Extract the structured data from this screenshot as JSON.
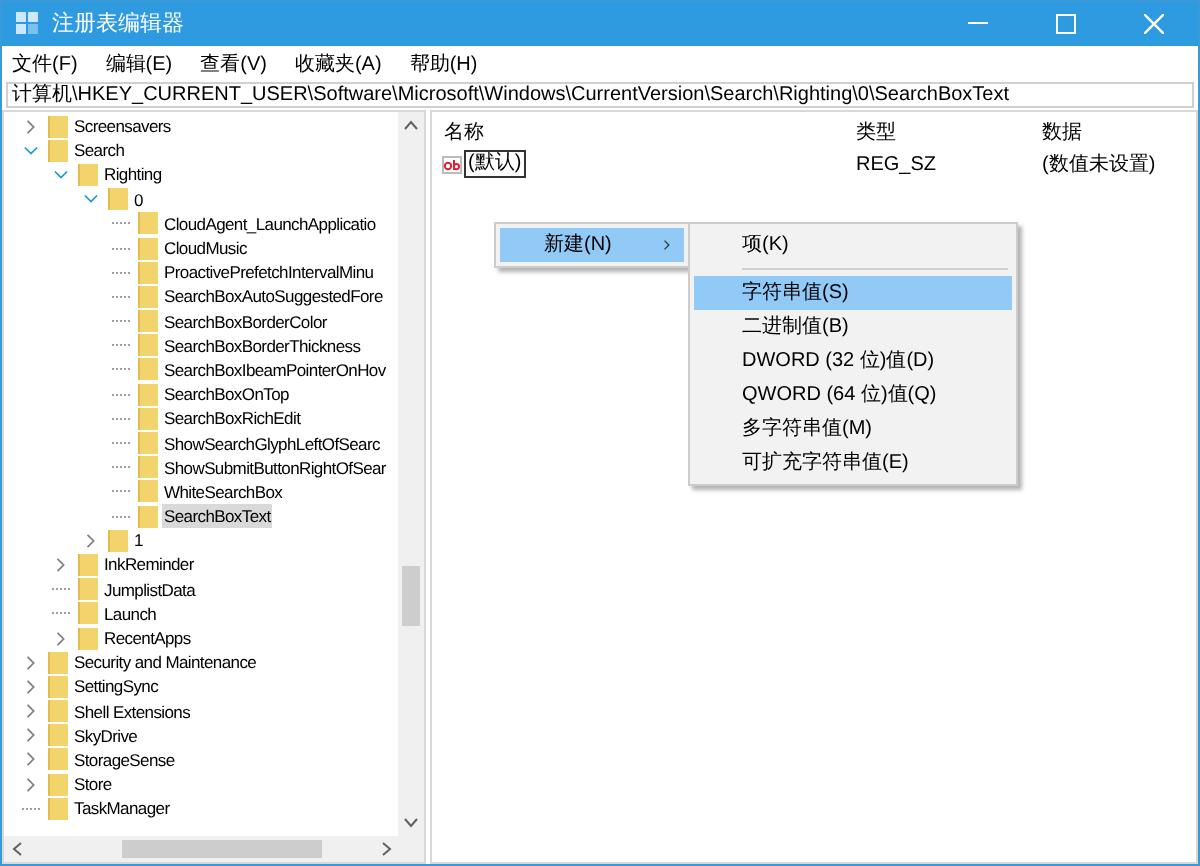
{
  "window": {
    "title": "注册表编辑器"
  },
  "menu_bar": [
    "文件(F)",
    "编辑(E)",
    "查看(V)",
    "收藏夹(A)",
    "帮助(H)"
  ],
  "address_bar": {
    "value": "计算机\\HKEY_CURRENT_USER\\Software\\Microsoft\\Windows\\CurrentVersion\\Search\\Righting\\0\\SearchBoxText"
  },
  "tree": {
    "items": [
      {
        "label": "Screensavers",
        "kind": "branch",
        "expanded": false,
        "selected": false
      },
      {
        "label": "Search",
        "kind": "branch",
        "expanded": true,
        "selected": false,
        "children": [
          {
            "label": "Righting",
            "kind": "branch",
            "expanded": true,
            "selected": false,
            "children": [
              {
                "label": "0",
                "kind": "branch",
                "expanded": true,
                "selected": false,
                "children": [
                  {
                    "label": "CloudAgent_LaunchApplicatio",
                    "kind": "leaf",
                    "selected": false
                  },
                  {
                    "label": "CloudMusic",
                    "kind": "leaf",
                    "selected": false
                  },
                  {
                    "label": "ProactivePrefetchIntervalMinu",
                    "kind": "leaf",
                    "selected": false
                  },
                  {
                    "label": "SearchBoxAutoSuggestedFore",
                    "kind": "leaf",
                    "selected": false
                  },
                  {
                    "label": "SearchBoxBorderColor",
                    "kind": "leaf",
                    "selected": false
                  },
                  {
                    "label": "SearchBoxBorderThickness",
                    "kind": "leaf",
                    "selected": false
                  },
                  {
                    "label": "SearchBoxIbeamPointerOnHov",
                    "kind": "leaf",
                    "selected": false
                  },
                  {
                    "label": "SearchBoxOnTop",
                    "kind": "leaf",
                    "selected": false
                  },
                  {
                    "label": "SearchBoxRichEdit",
                    "kind": "leaf",
                    "selected": false
                  },
                  {
                    "label": "ShowSearchGlyphLeftOfSearc",
                    "kind": "leaf",
                    "selected": false
                  },
                  {
                    "label": "ShowSubmitButtonRightOfSear",
                    "kind": "leaf",
                    "selected": false
                  },
                  {
                    "label": "WhiteSearchBox",
                    "kind": "leaf",
                    "selected": false
                  },
                  {
                    "label": "SearchBoxText",
                    "kind": "leaf",
                    "selected": true
                  }
                ]
              },
              {
                "label": "1",
                "kind": "branch",
                "expanded": false,
                "selected": false
              }
            ]
          },
          {
            "label": "InkReminder",
            "kind": "branch",
            "expanded": false,
            "selected": false
          },
          {
            "label": "JumplistData",
            "kind": "leaf",
            "selected": false
          },
          {
            "label": "Launch",
            "kind": "leaf",
            "selected": false
          },
          {
            "label": "RecentApps",
            "kind": "branch",
            "expanded": false,
            "selected": false
          }
        ]
      },
      {
        "label": "Security and Maintenance",
        "kind": "branch",
        "expanded": false,
        "selected": false
      },
      {
        "label": "SettingSync",
        "kind": "branch",
        "expanded": false,
        "selected": false
      },
      {
        "label": "Shell Extensions",
        "kind": "branch",
        "expanded": false,
        "selected": false
      },
      {
        "label": "SkyDrive",
        "kind": "branch",
        "expanded": false,
        "selected": false
      },
      {
        "label": "StorageSense",
        "kind": "branch",
        "expanded": false,
        "selected": false
      },
      {
        "label": "Store",
        "kind": "branch",
        "expanded": false,
        "selected": false
      },
      {
        "label": "TaskManager",
        "kind": "leaf",
        "selected": false
      }
    ]
  },
  "values_table": {
    "columns": [
      "名称",
      "类型",
      "数据"
    ],
    "rows": [
      {
        "name": "(默认)",
        "type": "REG_SZ",
        "data": "(数值未设置)",
        "editing": true
      }
    ]
  },
  "context_menu": {
    "items": [
      {
        "label": "新建(N)",
        "selected": true,
        "has_submenu": true
      }
    ]
  },
  "submenu": {
    "items": [
      {
        "kind": "item",
        "label": "项(K)",
        "selected": false
      },
      {
        "kind": "separator"
      },
      {
        "kind": "item",
        "label": "字符串值(S)",
        "selected": true
      },
      {
        "kind": "item",
        "label": "二进制值(B)",
        "selected": false
      },
      {
        "kind": "item",
        "label": "DWORD (32 位)值(D)",
        "selected": false
      },
      {
        "kind": "item",
        "label": "QWORD (64 位)值(Q)",
        "selected": false
      },
      {
        "kind": "item",
        "label": "多字符串值(M)",
        "selected": false
      },
      {
        "kind": "item",
        "label": "可扩充字符串值(E)",
        "selected": false
      }
    ]
  }
}
